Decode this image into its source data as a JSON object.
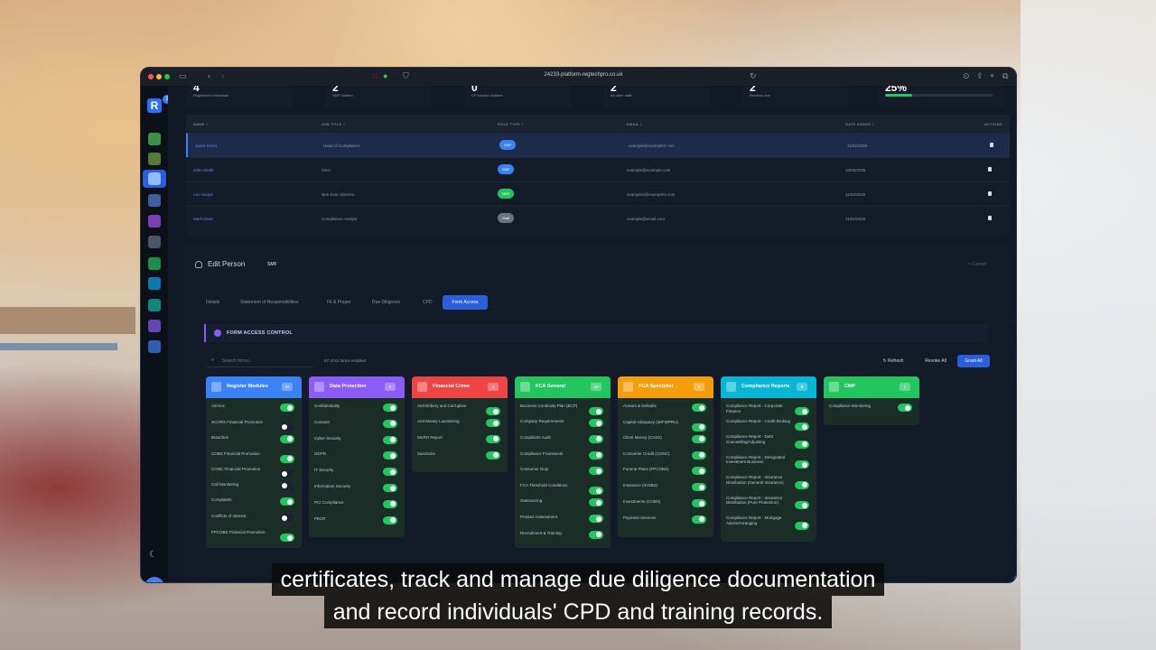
{
  "browser": {
    "url": "24233-platform-regtechpro.co.uk"
  },
  "sidebar": {
    "logo": "R",
    "logo_badge": "3"
  },
  "stats": [
    {
      "number": "4",
      "label": "Registered individuals"
    },
    {
      "number": "2",
      "label": "SMF holders"
    },
    {
      "number": "0",
      "label": "CF function holders"
    },
    {
      "number": "2",
      "label": "All other staff"
    },
    {
      "number": "2",
      "label": "Reviews due"
    },
    {
      "number": "25%",
      "progress": 0.25
    }
  ],
  "table": {
    "headers": {
      "name": "NAME ↑",
      "job": "JOB TITLE ↕",
      "role": "ROLE TYPE ↕",
      "email": "EMAIL ↕",
      "date": "DATE ADDED ↕",
      "actions": "ACTIONS"
    },
    "rows": [
      {
        "name": "Janet Jones",
        "job": "Head of Compliance",
        "role": "SMF",
        "role_color": "#3b82f6",
        "email": "example@example2.com",
        "date": "11/02/2026"
      },
      {
        "name": "John Smith",
        "job": "CEO",
        "role": "SMF",
        "role_color": "#3b82f6",
        "email": "example@example.com",
        "date": "10/02/2026"
      },
      {
        "name": "Leo Hoops",
        "job": "Non Exec Director",
        "role": "NED",
        "role_color": "#22c55e",
        "email": "example3@example3.com",
        "date": "11/02/2026"
      },
      {
        "name": "Mark Dean",
        "job": "Compliance Analyst",
        "role": "Staff",
        "role_color": "#6b7280",
        "email": "example@email.com",
        "date": "11/02/2026"
      }
    ]
  },
  "edit_person": {
    "title": "Edit Person",
    "role": "SMF",
    "cancel": "× Cancel",
    "tabs": [
      "Details",
      "Statement of Responsibilities",
      "Fit & Proper",
      "Due Diligence",
      "CPD",
      "Form Access"
    ],
    "active_tab": "Form Access",
    "section_title": "FORM ACCESS CONTROL",
    "search_placeholder": "Search forms...",
    "count": "57 of 61 forms enabled",
    "refresh": "Refresh",
    "revoke_all": "Revoke All",
    "grant_all": "Grant All"
  },
  "cards": [
    {
      "title": "Register Modules",
      "count": "11",
      "color": "#3b82f6",
      "items": [
        {
          "label": "Ad-Hoc",
          "on": true
        },
        {
          "label": "SCORS Financial Promotion",
          "on": false
        },
        {
          "label": "Breaches",
          "on": true
        },
        {
          "label": "COBS Financial Promotion",
          "on": true
        },
        {
          "label": "CONC Financial Promotion",
          "on": false
        },
        {
          "label": "Call Monitoring",
          "on": false
        },
        {
          "label": "Complaints",
          "on": true
        },
        {
          "label": "Conflicts of Interest",
          "on": false
        },
        {
          "label": "FPCOBS Financial Promotion",
          "on": true
        }
      ]
    },
    {
      "title": "Data Protection",
      "count": "8",
      "color": "#8b5cf6",
      "items": [
        {
          "label": "Confidentiality",
          "on": true
        },
        {
          "label": "Consent",
          "on": true
        },
        {
          "label": "Cyber Security",
          "on": true
        },
        {
          "label": "GDPR",
          "on": true
        },
        {
          "label": "IT Security",
          "on": true
        },
        {
          "label": "Information Security",
          "on": true
        },
        {
          "label": "PCI Compliance",
          "on": true
        },
        {
          "label": "PECR",
          "on": true
        }
      ]
    },
    {
      "title": "Financial Crime",
      "count": "4",
      "color": "#ef4444",
      "items": [
        {
          "label": "Anti-Bribery and Corruption",
          "on": true
        },
        {
          "label": "Anti-Money Laundering",
          "on": true
        },
        {
          "label": "MLRO Report",
          "on": true
        },
        {
          "label": "Sanctions",
          "on": true
        }
      ]
    },
    {
      "title": "FCA General",
      "count": "10",
      "color": "#22c55e",
      "items": [
        {
          "label": "Business Continuity Plan (BCP)",
          "on": true
        },
        {
          "label": "Company Requirements",
          "on": true
        },
        {
          "label": "Complaints Audit",
          "on": true
        },
        {
          "label": "Compliance Framework",
          "on": true
        },
        {
          "label": "Consumer Duty",
          "on": true
        },
        {
          "label": "FCA Threshold Conditions",
          "on": true
        },
        {
          "label": "Outsourcing",
          "on": true
        },
        {
          "label": "Product Assessment",
          "on": true
        },
        {
          "label": "Recruitment & Training",
          "on": true
        }
      ]
    },
    {
      "title": "FCA Specialist",
      "count": "8",
      "color": "#f59e0b",
      "items": [
        {
          "label": "Arrears & Defaults",
          "on": true
        },
        {
          "label": "Capital Adequacy (MIFIDPRU)",
          "on": true
        },
        {
          "label": "Client Money (CASS)",
          "on": true
        },
        {
          "label": "Consumer Credit (CONC)",
          "on": true
        },
        {
          "label": "Funeral Plans (FPCOBS)",
          "on": true
        },
        {
          "label": "Insurance (ICOBS)",
          "on": true
        },
        {
          "label": "Investments (COBS)",
          "on": true
        },
        {
          "label": "Payment Services",
          "on": true
        }
      ]
    },
    {
      "title": "Compliance Reports",
      "count": "8",
      "color": "#06b6d4",
      "items": [
        {
          "label": "Compliance Report - Corporate Finance",
          "on": true
        },
        {
          "label": "Compliance Report - Credit Broking",
          "on": true
        },
        {
          "label": "Compliance Report - Debt Counselling/Adjusting",
          "on": true
        },
        {
          "label": "Compliance Report - Designated Investment Business",
          "on": true
        },
        {
          "label": "Compliance Report - Insurance Distribution (General Insurance)",
          "on": true
        },
        {
          "label": "Compliance Report - Insurance Distribution (Pure Protection)",
          "on": true
        },
        {
          "label": "Compliance Report - Mortgage Advice/Arranging",
          "on": true
        }
      ]
    },
    {
      "title": "CMP",
      "count": "1",
      "color": "#22c55e",
      "items": [
        {
          "label": "Compliance Monitoring",
          "on": true
        }
      ]
    }
  ],
  "subtitles": {
    "line1": "certificates, track and manage due diligence documentation",
    "line2": "and record individuals' CPD and training records."
  }
}
